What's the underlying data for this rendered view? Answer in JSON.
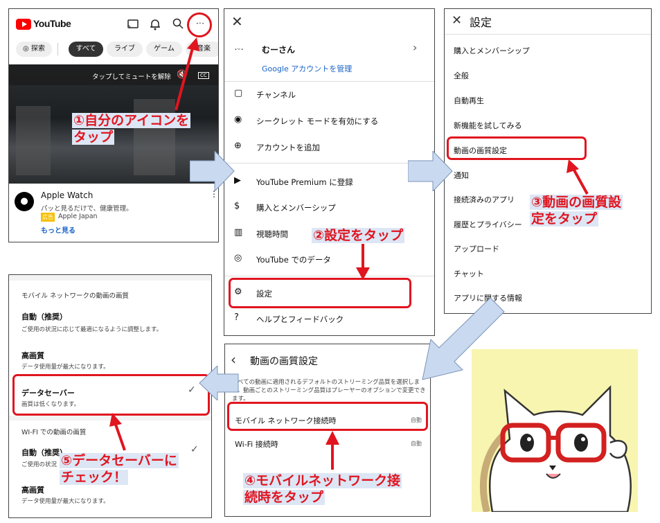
{
  "p1": {
    "brand": "YouTube",
    "chips": [
      "探索",
      "すべて",
      "ライブ",
      "ゲーム",
      "音楽"
    ],
    "mute_hint": "タップしてミュートを解除",
    "cc": "CC",
    "ad_title": "Apple Watch",
    "ad_desc": "パッと見るだけで、健康管理。",
    "ad_badge": "広告",
    "ad_advertiser": "Apple Japan",
    "ad_more": "もっと見る"
  },
  "p2": {
    "user_name": "むーさん",
    "manage_account": "Google アカウントを管理",
    "items": [
      "チャンネル",
      "シークレット モードを有効にする",
      "アカウントを追加",
      "YouTube Premium に登録",
      "購入とメンバーシップ",
      "視聴時間",
      "YouTube でのデータ",
      "設定",
      "ヘルプとフィードバック"
    ]
  },
  "p3": {
    "title": "設定",
    "items": [
      "購入とメンバーシップ",
      "全般",
      "自動再生",
      "新機能を試してみる",
      "動画の画質設定",
      "通知",
      "接続済みのアプリ",
      "履歴とプライバシー",
      "アップロード",
      "チャット",
      "アプリに関する情報"
    ]
  },
  "p4": {
    "title": "動画の画質設定",
    "desc": "すべての動画に適用されるデフォルトのストリーミング品質を選択します。動画ごとのストリーミング品質はプレーヤーのオプションで変更できます。",
    "rows": [
      {
        "label": "モバイル ネットワーク接続時",
        "value": "自動"
      },
      {
        "label": "Wi-Fi 接続時",
        "value": "自動"
      }
    ]
  },
  "p5": {
    "section1": "モバイル ネットワークの動画の画質",
    "opt_auto": "自動（推奨）",
    "opt_auto_desc": "ご使用の状況に応じて最適になるように調整します。",
    "opt_high": "高画質",
    "opt_high_desc": "データ使用量が最大になります。",
    "opt_saver": "データセーバー",
    "opt_saver_desc": "画質は低くなります。",
    "section2": "WI-FI での動画の画質",
    "opt2_auto": "自動（推奨）",
    "opt2_auto_desc": "ご使用の状況",
    "opt2_high": "高画質",
    "opt2_high_desc": "データ使用量が最大になります。"
  },
  "callouts": {
    "c1a": "①自分のアイコンを",
    "c1b": "タップ",
    "c2": "②設定をタップ",
    "c3a": "③動画の画質設",
    "c3b": "定をタップ",
    "c4a": "④モバイルネットワーク接",
    "c4b": "続時をタップ",
    "c5a": "⑤データセーバーに",
    "c5b": "チェック！"
  },
  "colors": {
    "accent_red": "#e0151f",
    "highlight": "#dce6f5",
    "arrow_blue": "#c9d9ef",
    "cat_bg": "#f7f5b0"
  }
}
